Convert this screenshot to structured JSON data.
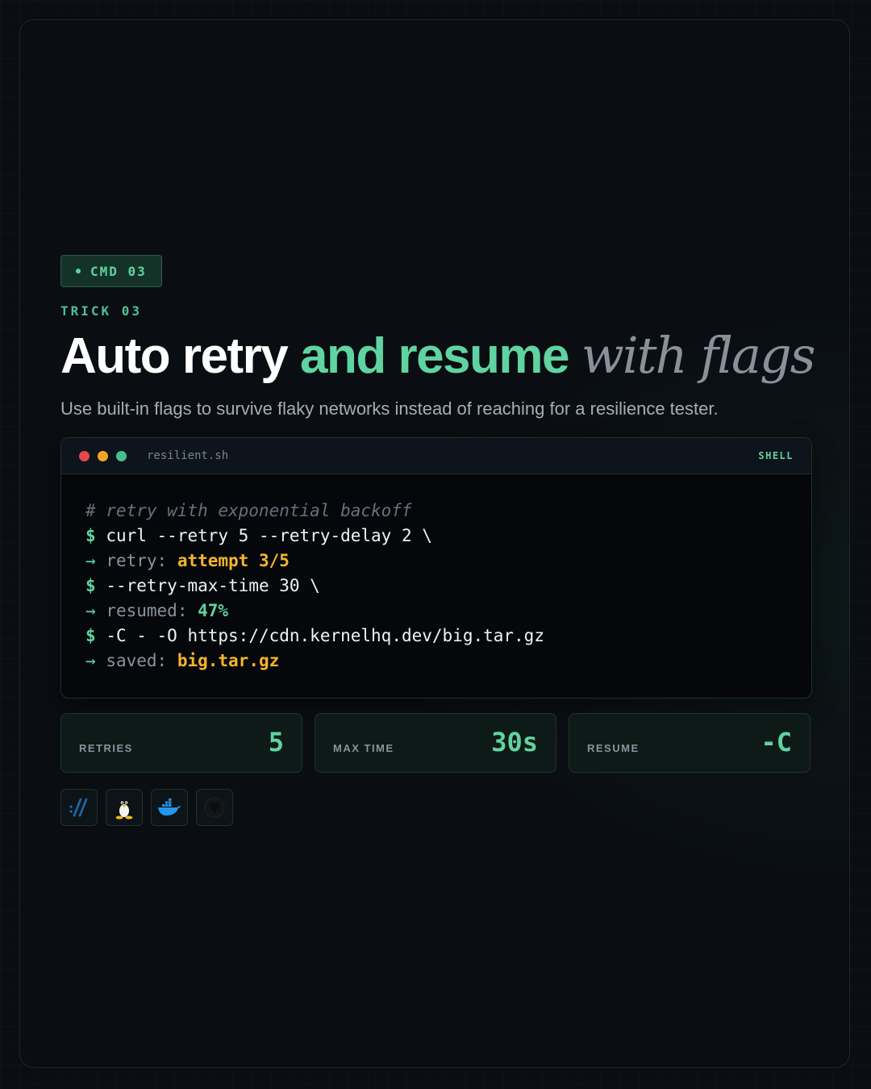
{
  "badge": {
    "label": "CMD 03"
  },
  "eyebrow": "TRICK 03",
  "title": {
    "part1": "Auto retry",
    "part2": "and resume",
    "part3": "with flags"
  },
  "subtitle": "Use built-in flags to survive flaky networks instead of reaching for a resilience tester.",
  "terminal": {
    "filename": "resilient.sh",
    "language": "SHELL",
    "prompt_symbol": "$",
    "arrow_symbol": "→",
    "lines": {
      "comment": "# retry with exponential backoff",
      "cmd1": "curl --retry 5 --retry-delay 2 \\",
      "out1_label": "retry:",
      "out1_value": "attempt 3/5",
      "cmd2": "--retry-max-time 30 \\",
      "out2_label": "resumed:",
      "out2_value": "47%",
      "cmd3": "-C - -O https://cdn.kernelhq.dev/big.tar.gz",
      "out3_label": "saved:",
      "out3_value": "big.tar.gz"
    }
  },
  "stats": [
    {
      "label": "RETRIES",
      "value": "5"
    },
    {
      "label": "MAX TIME",
      "value": "30s"
    },
    {
      "label": "RESUME",
      "value": "-C"
    }
  ],
  "icons": [
    "terminal-slashes-icon",
    "linux-tux-icon",
    "docker-whale-icon",
    "github-octocat-icon"
  ],
  "colors": {
    "accent": "#5fd4a0",
    "highlight": "#f4b52a",
    "background": "#0a0d12"
  }
}
